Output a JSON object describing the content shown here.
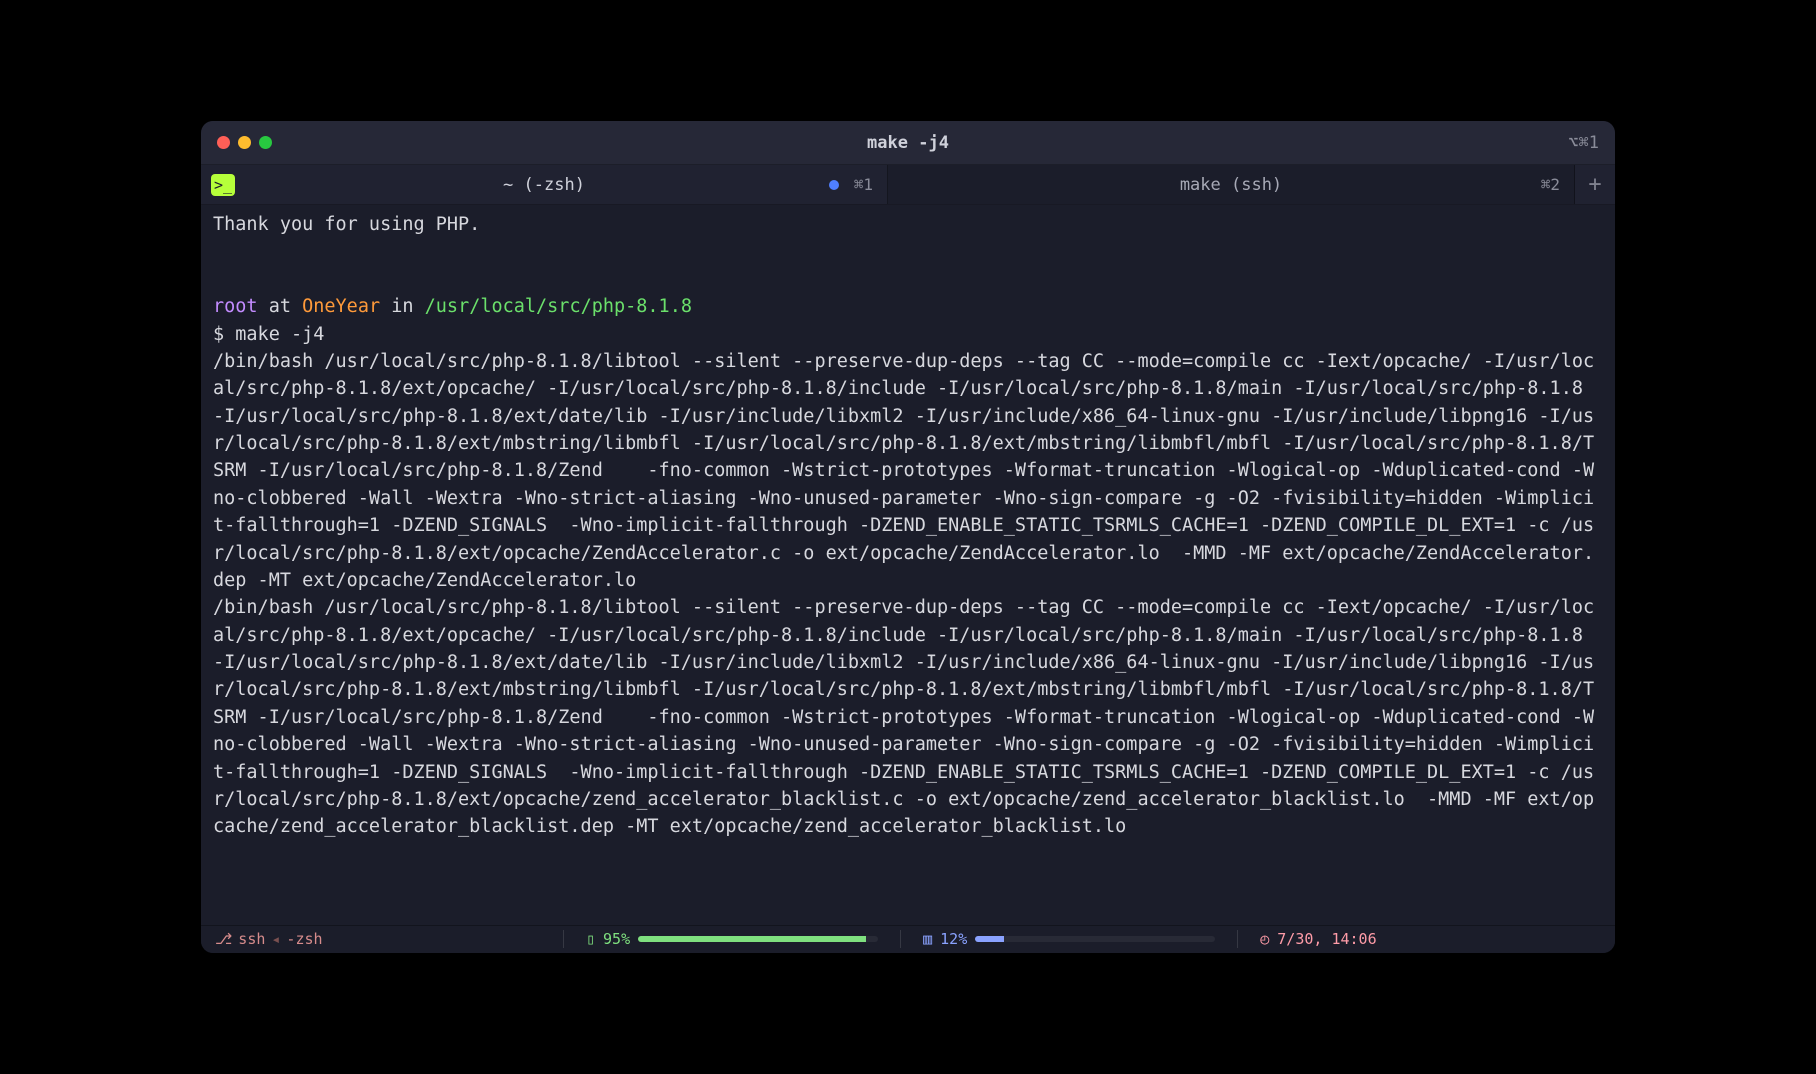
{
  "window": {
    "title": "make -j4",
    "title_shortcut": "⌥⌘1"
  },
  "tabs": [
    {
      "label": "~ (-zsh)",
      "shortcut": "⌘1",
      "has_badge": true,
      "active": true
    },
    {
      "label": "make (ssh)",
      "shortcut": "⌘2",
      "has_badge": false,
      "active": false
    }
  ],
  "prompt": {
    "user": "root",
    "at": "at",
    "host": "OneYear",
    "in": "in",
    "path": "/usr/local/src/php-8.1.8",
    "symbol": "$",
    "command": "make -j4"
  },
  "scrollback_top": "Thank you for using PHP.",
  "output_lines": [
    "/bin/bash /usr/local/src/php-8.1.8/libtool --silent --preserve-dup-deps --tag CC --mode=compile cc -Iext/opcache/ -I/usr/local/src/php-8.1.8/ext/opcache/ -I/usr/local/src/php-8.1.8/include -I/usr/local/src/php-8.1.8/main -I/usr/local/src/php-8.1.8 -I/usr/local/src/php-8.1.8/ext/date/lib -I/usr/include/libxml2 -I/usr/include/x86_64-linux-gnu -I/usr/include/libpng16 -I/usr/local/src/php-8.1.8/ext/mbstring/libmbfl -I/usr/local/src/php-8.1.8/ext/mbstring/libmbfl/mbfl -I/usr/local/src/php-8.1.8/TSRM -I/usr/local/src/php-8.1.8/Zend    -fno-common -Wstrict-prototypes -Wformat-truncation -Wlogical-op -Wduplicated-cond -Wno-clobbered -Wall -Wextra -Wno-strict-aliasing -Wno-unused-parameter -Wno-sign-compare -g -O2 -fvisibility=hidden -Wimplicit-fallthrough=1 -DZEND_SIGNALS  -Wno-implicit-fallthrough -DZEND_ENABLE_STATIC_TSRMLS_CACHE=1 -DZEND_COMPILE_DL_EXT=1 -c /usr/local/src/php-8.1.8/ext/opcache/ZendAccelerator.c -o ext/opcache/ZendAccelerator.lo  -MMD -MF ext/opcache/ZendAccelerator.dep -MT ext/opcache/ZendAccelerator.lo",
    "/bin/bash /usr/local/src/php-8.1.8/libtool --silent --preserve-dup-deps --tag CC --mode=compile cc -Iext/opcache/ -I/usr/local/src/php-8.1.8/ext/opcache/ -I/usr/local/src/php-8.1.8/include -I/usr/local/src/php-8.1.8/main -I/usr/local/src/php-8.1.8 -I/usr/local/src/php-8.1.8/ext/date/lib -I/usr/include/libxml2 -I/usr/include/x86_64-linux-gnu -I/usr/include/libpng16 -I/usr/local/src/php-8.1.8/ext/mbstring/libmbfl -I/usr/local/src/php-8.1.8/ext/mbstring/libmbfl/mbfl -I/usr/local/src/php-8.1.8/TSRM -I/usr/local/src/php-8.1.8/Zend    -fno-common -Wstrict-prototypes -Wformat-truncation -Wlogical-op -Wduplicated-cond -Wno-clobbered -Wall -Wextra -Wno-strict-aliasing -Wno-unused-parameter -Wno-sign-compare -g -O2 -fvisibility=hidden -Wimplicit-fallthrough=1 -DZEND_SIGNALS  -Wno-implicit-fallthrough -DZEND_ENABLE_STATIC_TSRMLS_CACHE=1 -DZEND_COMPILE_DL_EXT=1 -c /usr/local/src/php-8.1.8/ext/opcache/zend_accelerator_blacklist.c -o ext/opcache/zend_accelerator_blacklist.lo  -MMD -MF ext/opcache/zend_accelerator_blacklist.dep -MT ext/opcache/zend_accelerator_blacklist.lo"
  ],
  "status": {
    "branch_icon": "⎇",
    "conn": "ssh",
    "sep": "◂",
    "shell": "-zsh",
    "battery_pct": "95%",
    "battery_fill": 95,
    "mem_pct": "12%",
    "mem_fill": 12,
    "clock_icon": "◴",
    "time": "7/30, 14:06"
  },
  "icons": {
    "prompt_glyph": ">_",
    "battery": "▯",
    "chip": "▥"
  }
}
